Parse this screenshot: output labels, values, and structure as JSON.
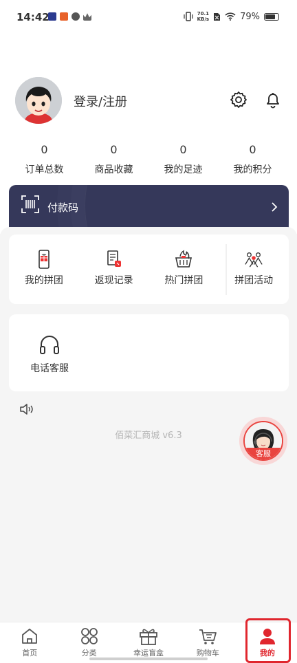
{
  "status_bar": {
    "time": "14:42",
    "network_speed_value": "70.1",
    "network_speed_unit": "KB/s",
    "battery": "79%"
  },
  "profile": {
    "login_text": "登录/注册"
  },
  "stats": [
    {
      "value": "0",
      "label": "订单总数"
    },
    {
      "value": "0",
      "label": "商品收藏"
    },
    {
      "value": "0",
      "label": "我的足迹"
    },
    {
      "value": "0",
      "label": "我的积分"
    }
  ],
  "pay_card": {
    "label": "付款码"
  },
  "features": [
    {
      "label": "我的拼团",
      "icon": "phone-gift-icon"
    },
    {
      "label": "返现记录",
      "icon": "cashback-record-icon"
    },
    {
      "label": "热门拼团",
      "icon": "hot-basket-icon"
    },
    {
      "label": "拼团活动",
      "icon": "group-people-icon"
    }
  ],
  "services": {
    "phone_service_label": "电话客服"
  },
  "version": "佰菜汇商城 v6.3",
  "float_service": {
    "label": "客服"
  },
  "tabbar": {
    "tabs": [
      {
        "label": "首页",
        "icon": "home-icon"
      },
      {
        "label": "分类",
        "icon": "category-icon"
      },
      {
        "label": "幸运盲盒",
        "icon": "gift-box-icon"
      },
      {
        "label": "购物车",
        "icon": "cart-icon"
      },
      {
        "label": "我的",
        "icon": "user-icon"
      }
    ],
    "active_color": "#e0262e"
  }
}
